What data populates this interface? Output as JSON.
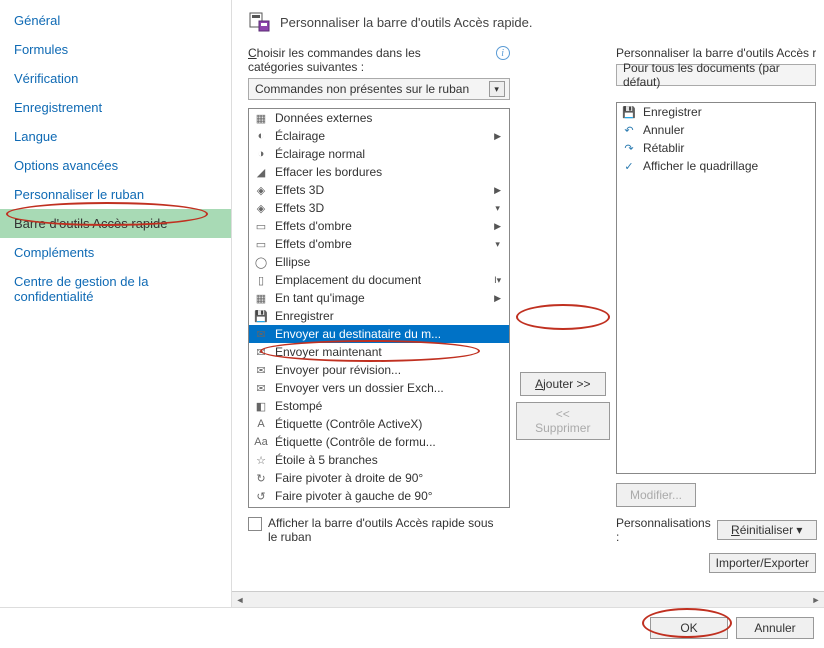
{
  "title": "Personnaliser la barre d'outils Accès rapide.",
  "sidebar": {
    "items": [
      "Général",
      "Formules",
      "Vérification",
      "Enregistrement",
      "Langue",
      "Options avancées",
      "Personnaliser le ruban",
      "Barre d'outils Accès rapide",
      "Compléments",
      "Centre de gestion de la confidentialité"
    ],
    "selected_index": 7
  },
  "left": {
    "choose_label": "Choisir les commandes dans les catégories suivantes :",
    "category": "Commandes non présentes sur le ruban",
    "commands": [
      {
        "txt": "Données externes",
        "sub": ""
      },
      {
        "txt": "Éclairage",
        "sub": "▶"
      },
      {
        "txt": "Éclairage normal",
        "sub": ""
      },
      {
        "txt": "Effacer les bordures",
        "sub": ""
      },
      {
        "txt": "Effets 3D",
        "sub": "▶"
      },
      {
        "txt": "Effets 3D",
        "sub": "▾"
      },
      {
        "txt": "Effets d'ombre",
        "sub": "▶"
      },
      {
        "txt": "Effets d'ombre",
        "sub": "▾"
      },
      {
        "txt": "Ellipse",
        "sub": ""
      },
      {
        "txt": "Emplacement du document",
        "sub": "I▾"
      },
      {
        "txt": "En tant qu'image",
        "sub": "▶"
      },
      {
        "txt": "Enregistrer",
        "sub": ""
      },
      {
        "txt": "Envoyer au destinataire du m...",
        "sub": "",
        "selected": true
      },
      {
        "txt": "Envoyer maintenant",
        "sub": ""
      },
      {
        "txt": "Envoyer pour révision...",
        "sub": ""
      },
      {
        "txt": "Envoyer vers un dossier Exch...",
        "sub": ""
      },
      {
        "txt": "Estompé",
        "sub": ""
      },
      {
        "txt": "Étiquette (Contrôle ActiveX)",
        "sub": ""
      },
      {
        "txt": "Étiquette (Contrôle de formu...",
        "sub": ""
      },
      {
        "txt": "Étoile à 5 branches",
        "sub": ""
      },
      {
        "txt": "Faire pivoter à droite de 90°",
        "sub": ""
      },
      {
        "txt": "Faire pivoter à gauche de 90°",
        "sub": ""
      }
    ]
  },
  "mid": {
    "add": "Ajouter >>",
    "remove": "<< Supprimer"
  },
  "right": {
    "customize_label": "Personnaliser la barre d'outils Accès rapide :",
    "scope": "Pour tous les documents (par défaut)",
    "items": [
      {
        "txt": "Enregistrer",
        "ico": "💾"
      },
      {
        "txt": "Annuler",
        "ico": "↶"
      },
      {
        "txt": "Rétablir",
        "ico": "↷"
      },
      {
        "txt": "Afficher le quadrillage",
        "ico": "✓"
      }
    ],
    "modify": "Modifier...",
    "personalizations": "Personnalisations :",
    "reset": "Réinitialiser ▾",
    "import": "Importer/Exporter"
  },
  "below_ribbon": "Afficher la barre d'outils Accès rapide sous le ruban",
  "footer": {
    "ok": "OK",
    "cancel": "Annuler"
  }
}
